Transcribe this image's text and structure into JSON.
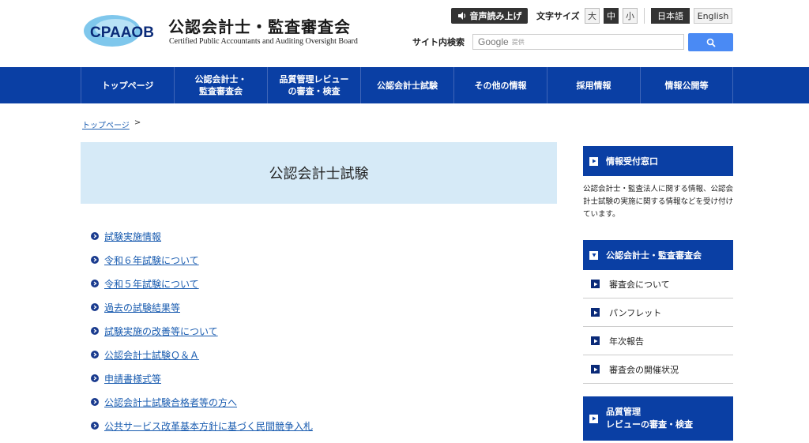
{
  "header": {
    "logo_mark": "CPAAOB",
    "logo_jp": "公認会計士・監査審査会",
    "logo_en": "Certified Public Accountants and Auditing Oversight Board",
    "voice_label": "音声読み上げ",
    "font_size_label": "文字サイズ",
    "font_sizes": [
      "大",
      "中",
      "小"
    ],
    "font_size_selected": "中",
    "lang_jp": "日本語",
    "lang_en": "English",
    "search_label": "サイト内検索",
    "search_brand": "Google",
    "search_provided": "提供"
  },
  "nav": {
    "items": [
      "トップページ",
      "公認会計士・\n監査審査会",
      "品質管理レビュー\nの審査・検査",
      "公認会計士試験",
      "その他の情報",
      "採用情報",
      "情報公開等"
    ]
  },
  "breadcrumb": {
    "home": "トップページ",
    "sep": ">"
  },
  "main": {
    "title": "公認会計士試験",
    "links": [
      "試験実施情報",
      "令和６年試験について",
      "令和５年試験について",
      "過去の試験結果等",
      "試験実施の改善等について",
      "公認会計士試験Ｑ＆Ａ",
      "申請書様式等",
      "公認会計士試験合格者等の方へ",
      "公共サービス改革基本方針に基づく民間競争入札"
    ]
  },
  "sidebar": {
    "info_title": "情報受付窓口",
    "info_text": "公認会計士・監査法人に関する情報、公認会計士試験の実施に関する情報などを受け付けています。",
    "board_title": "公認会計士・監査審査会",
    "board_items": [
      "審査会について",
      "パンフレット",
      "年次報告",
      "審査会の開催状況"
    ],
    "review_title_1": "品質管理",
    "review_title_2": "レビューの審査・検査"
  },
  "colors": {
    "nav_bg": "#0a3fa4",
    "title_bg": "#d6eaf7",
    "link": "#1a5cb0",
    "search_btn": "#4a8af4"
  }
}
